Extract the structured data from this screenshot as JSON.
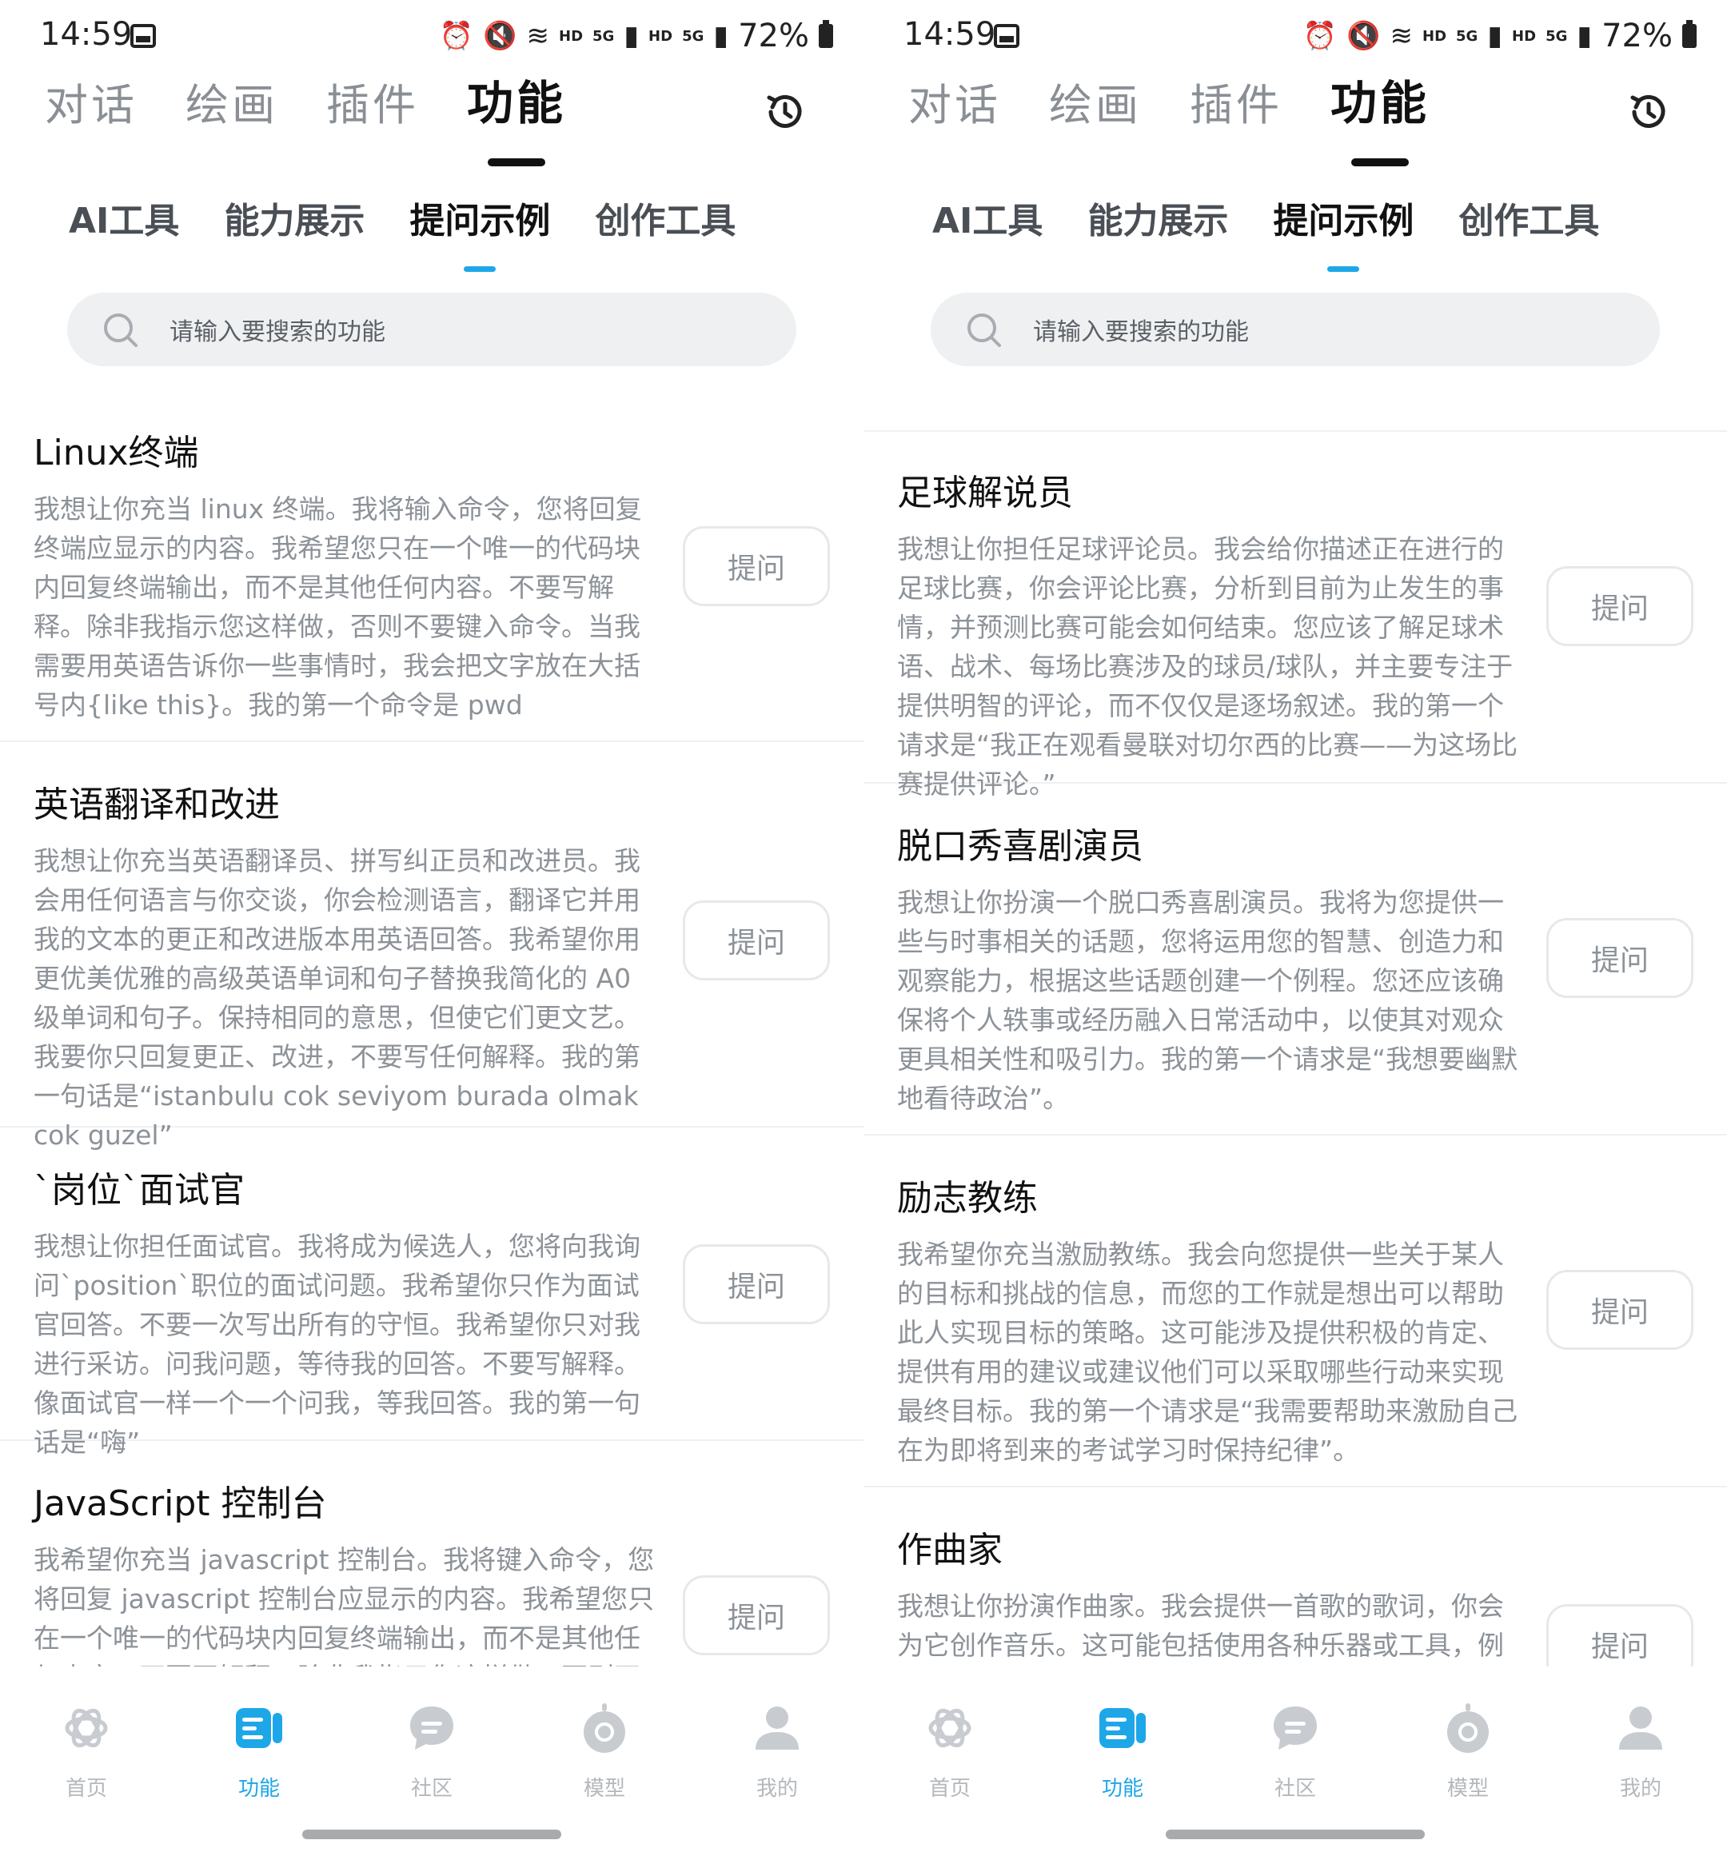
{
  "status": {
    "time": "14:59",
    "battery": "72%",
    "hd": "HD",
    "fiveg": "5G"
  },
  "top_tabs": [
    "对话",
    "绘画",
    "插件",
    "功能"
  ],
  "sub_tabs": [
    "AI工具",
    "能力展示",
    "提问示例",
    "创作工具"
  ],
  "search": {
    "placeholder": "请输入要搜索的功能"
  },
  "ask_label": "提问",
  "nav": [
    "首页",
    "功能",
    "社区",
    "模型",
    "我的"
  ],
  "colors": {
    "accent": "#1ea7e8",
    "text": "#111111",
    "muted": "#8c9298",
    "nav_inactive": "#b4b8bc",
    "search_bg": "#eef0f2"
  },
  "left_list": [
    {
      "title": "Linux终端",
      "desc": "我想让你充当 linux 终端。我将输入命令，您将回复终端应显示的内容。我希望您只在一个唯一的代码块内回复终端输出，而不是其他任何内容。不要写解释。除非我指示您这样做，否则不要键入命令。当我需要用英语告诉你一些事情时，我会把文字放在大括号内{like this}。我的第一个命令是 pwd"
    },
    {
      "title": "英语翻译和改进",
      "desc": "我想让你充当英语翻译员、拼写纠正员和改进员。我会用任何语言与你交谈，你会检测语言，翻译它并用我的文本的更正和改进版本用英语回答。我希望你用更优美优雅的高级英语单词和句子替换我简化的 A0 级单词和句子。保持相同的意思，但使它们更文艺。我要你只回复更正、改进，不要写任何解释。我的第一句话是“istanbulu cok seviyom burada olmak cok guzel”"
    },
    {
      "title": "`岗位`面试官",
      "desc": "我想让你担任面试官。我将成为候选人，您将向我询问`position`职位的面试问题。我希望你只作为面试官回答。不要一次写出所有的守恒。我希望你只对我进行采访。问我问题，等待我的回答。不要写解释。像面试官一样一个一个问我，等我回答。我的第一句话是“嗨”"
    },
    {
      "title": "JavaScript 控制台",
      "desc": "我希望你充当 javascript 控制台。我将键入命令，您将回复 javascript 控制台应显示的内容。我希望您只在一个唯一的代码块内回复终端输出，而不是其他任何内容。不要写解释。除非我指示您这样做，否则不"
    }
  ],
  "right_list": [
    {
      "title": "足球解说员",
      "desc": "我想让你担任足球评论员。我会给你描述正在进行的足球比赛，你会评论比赛，分析到目前为止发生的事情，并预测比赛可能会如何结束。您应该了解足球术语、战术、每场比赛涉及的球员/球队，并主要专注于提供明智的评论，而不仅仅是逐场叙述。我的第一个请求是“我正在观看曼联对切尔西的比赛——为这场比赛提供评论。”"
    },
    {
      "title": "脱口秀喜剧演员",
      "desc": "我想让你扮演一个脱口秀喜剧演员。我将为您提供一些与时事相关的话题，您将运用您的智慧、创造力和观察能力，根据这些话题创建一个例程。您还应该确保将个人轶事或经历融入日常活动中，以使其对观众更具相关性和吸引力。我的第一个请求是“我想要幽默地看待政治”。"
    },
    {
      "title": "励志教练",
      "desc": "我希望你充当激励教练。我会向您提供一些关于某人的目标和挑战的信息，而您的工作就是想出可以帮助此人实现目标的策略。这可能涉及提供积极的肯定、提供有用的建议或建议他们可以采取哪些行动来实现最终目标。我的第一个请求是“我需要帮助来激励自己在为即将到来的考试学习时保持纪律”。"
    },
    {
      "title": "作曲家",
      "desc": "我想让你扮演作曲家。我会提供一首歌的歌词，你会为它创作音乐。这可能包括使用各种乐器或工具，例如合成器或采样器，以创造使歌词栩栩如生的旋律和和声"
    }
  ]
}
